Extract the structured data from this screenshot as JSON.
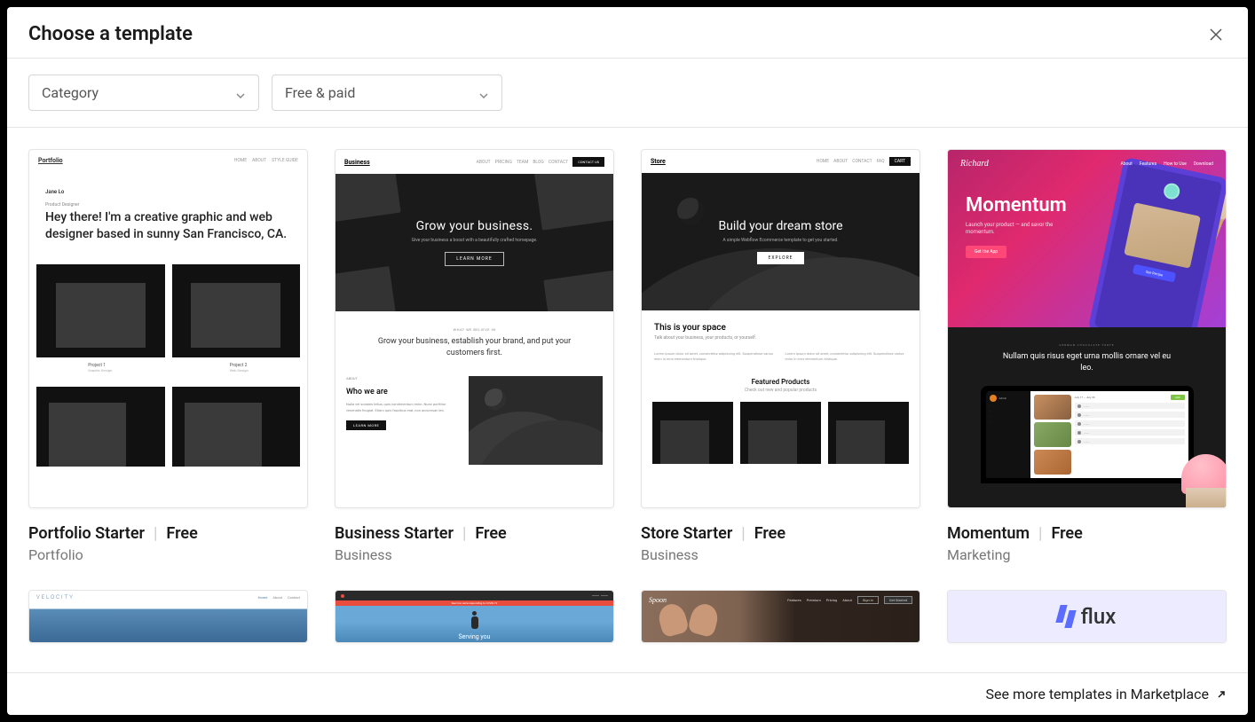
{
  "modal": {
    "title": "Choose a template",
    "close_label": "Close"
  },
  "filters": {
    "category": {
      "label": "Category"
    },
    "price": {
      "label": "Free & paid"
    }
  },
  "templates": [
    {
      "name": "Portfolio Starter",
      "price": "Free",
      "category": "Portfolio",
      "preview": {
        "logo": "Portfolio",
        "nav": [
          "HOME",
          "ABOUT",
          "STYLE GUIDE"
        ],
        "author_name": "Jane Lo",
        "author_role": "Product Designer",
        "headline": "Hey there! I'm a creative graphic and web designer based in sunny San Francisco, CA.",
        "project1": "Project 1",
        "project1_sub": "Graphic Design",
        "project2": "Project 2",
        "project2_sub": "Web Design"
      }
    },
    {
      "name": "Business Starter",
      "price": "Free",
      "category": "Business",
      "preview": {
        "logo": "Business",
        "nav": [
          "ABOUT",
          "PRICING",
          "TEAM",
          "BLOG",
          "CONTACT"
        ],
        "contact_btn": "CONTACT US",
        "hero_title": "Grow your business.",
        "hero_sub": "Give your business a boost with a beautifully crafted homepage.",
        "hero_btn": "LEARN MORE",
        "believe_label": "WHAT WE BELIEVE IN",
        "believe_text": "Grow your business, establish your brand, and put your customers first.",
        "about_label": "ABOUT",
        "about_title": "Who we are",
        "about_body": "Nulla vel sodales tellus, quis condimentum enim. Nunc porttitor venenatis feugiat. Etiam quis faucibus erat, non accumsan leo.",
        "about_btn": "LEARN MORE"
      }
    },
    {
      "name": "Store Starter",
      "price": "Free",
      "category": "Business",
      "preview": {
        "logo": "Store",
        "nav": [
          "HOME",
          "ABOUT",
          "CONTACT",
          "FAQ"
        ],
        "cart_btn": "CART",
        "hero_title": "Build your dream store",
        "hero_sub": "A simple Webflow Ecommerce template to get you started.",
        "hero_btn": "EXPLORE",
        "space_title": "This is your space",
        "space_sub": "Talk about your business, your products, or yourself.",
        "col_text": "Lorem ipsum dolor sit amet, consectetur adipiscing elit. Suspendisse varius enim in eros elementum tristique.",
        "featured_title": "Featured Products",
        "featured_sub": "Check out new and popular products"
      }
    },
    {
      "name": "Momentum",
      "price": "Free",
      "category": "Marketing",
      "preview": {
        "logo": "Richard",
        "nav": [
          "About",
          "Features",
          "How to Use",
          "Download"
        ],
        "hero_title": "Momentum",
        "hero_sub": "Launch your product — and savor the momentum.",
        "hero_btn": "Get the App",
        "phone_btn": "See Recipe",
        "dark_label": "GERMAN CHOCOLATE TORTE",
        "dark_text": "Nullam quis risus eget urna mollis ornare vel eu leo.",
        "sidebar_user": "Admin",
        "dates": "July 17 — July 30",
        "add_btn": "Add"
      }
    },
    {
      "name_partial": "Velocity",
      "preview": {
        "logo": "VELOCITY",
        "nav": [
          "Home",
          "About",
          "Contact"
        ]
      }
    },
    {
      "name_partial": "Serving",
      "preview": {
        "alert": "See how we're responding to COVID-19",
        "text": "Serving you"
      }
    },
    {
      "name_partial": "Spoon",
      "preview": {
        "logo": "Spoon",
        "nav": [
          "Features",
          "Premium",
          "Pricing",
          "About"
        ],
        "signin": "Sign in",
        "getstarted": "Get Started"
      }
    },
    {
      "name_partial": "Flux",
      "preview": {
        "logo": "flux"
      }
    }
  ],
  "footer": {
    "see_more": "See more templates in Marketplace"
  }
}
